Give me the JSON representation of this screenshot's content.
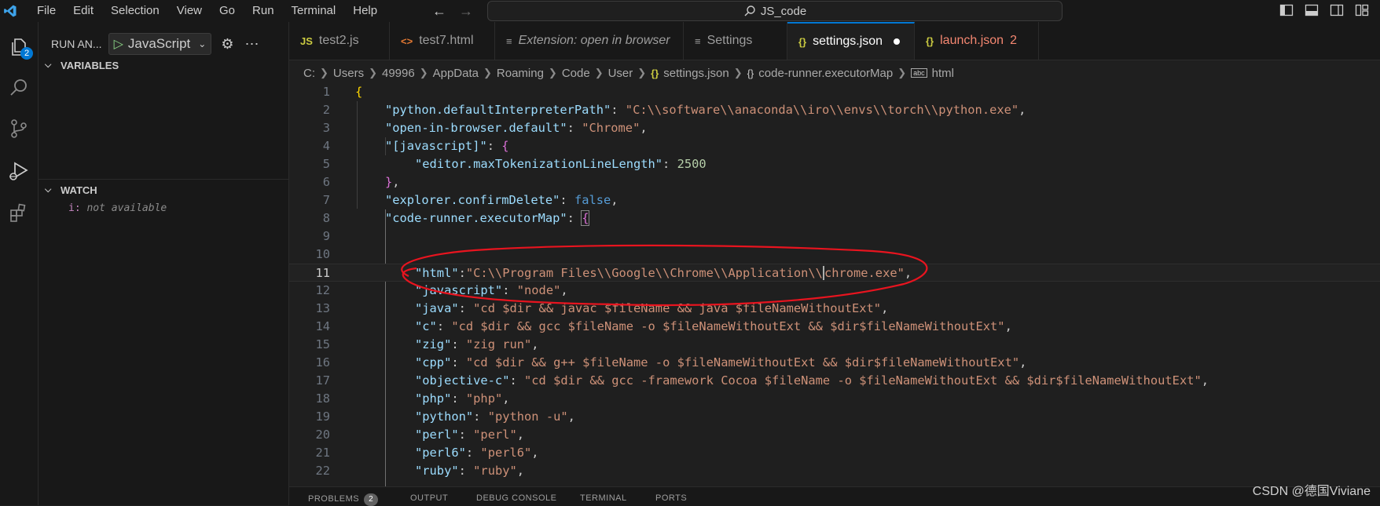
{
  "titlebar": {
    "menu": [
      "File",
      "Edit",
      "Selection",
      "View",
      "Go",
      "Run",
      "Terminal",
      "Help"
    ],
    "search_text": "JS_code"
  },
  "activitybar": {
    "explorer_badge": "2"
  },
  "sidebar": {
    "run_title": "RUN AN...",
    "launch_config": "JavaScript",
    "variables_header": "VARIABLES",
    "watch_header": "WATCH",
    "watch_item_name": "i:",
    "watch_item_value": "not available"
  },
  "tabs": [
    {
      "icon": "JS",
      "label": "test2.js"
    },
    {
      "icon": "<>",
      "label": "test7.html"
    },
    {
      "icon": "≡",
      "label": "Extension: open in browser"
    },
    {
      "icon": "≡",
      "label": "Settings"
    },
    {
      "icon": "{}",
      "label": "settings.json"
    },
    {
      "icon": "{}",
      "label": "launch.json",
      "count": "2"
    }
  ],
  "breadcrumb": [
    "C:",
    "Users",
    "49996",
    "AppData",
    "Roaming",
    "Code",
    "User",
    "settings.json",
    "code-runner.executorMap",
    "html"
  ],
  "editor": {
    "active_line": 11,
    "lines": [
      {
        "n": "1"
      },
      {
        "n": "2"
      },
      {
        "n": "3"
      },
      {
        "n": "4"
      },
      {
        "n": "5"
      },
      {
        "n": "6"
      },
      {
        "n": "7"
      },
      {
        "n": "8"
      },
      {
        "n": "9"
      },
      {
        "n": "10"
      },
      {
        "n": "11"
      },
      {
        "n": "12"
      },
      {
        "n": "13"
      },
      {
        "n": "14"
      },
      {
        "n": "15"
      },
      {
        "n": "16"
      },
      {
        "n": "17"
      },
      {
        "n": "18"
      },
      {
        "n": "19"
      },
      {
        "n": "20"
      },
      {
        "n": "21"
      },
      {
        "n": "22"
      }
    ],
    "tokens": {
      "l2k": "\"python.defaultInterpreterPath\"",
      "l2v": "\"C:\\\\software\\\\anaconda\\\\iro\\\\envs\\\\torch\\\\python.exe\"",
      "l3k": "\"open-in-browser.default\"",
      "l3v": "\"Chrome\"",
      "l4k": "\"[javascript]\"",
      "l5k": "\"editor.maxTokenizationLineLength\"",
      "l5v": "2500",
      "l7k": "\"explorer.confirmDelete\"",
      "l7v": "false",
      "l8k": "\"code-runner.executorMap\"",
      "l11k": "\"html\"",
      "l11v1": "\"C:\\\\Program Files\\\\Google\\\\Chrome\\\\Application\\\\",
      "l11v2": "chrome.exe\"",
      "l12k": "\"javascript\"",
      "l12v": "\"node\"",
      "l13k": "\"java\"",
      "l13v": "\"cd $dir && javac $fileName && java $fileNameWithoutExt\"",
      "l14k": "\"c\"",
      "l14v": "\"cd $dir && gcc $fileName -o $fileNameWithoutExt && $dir$fileNameWithoutExt\"",
      "l15k": "\"zig\"",
      "l15v": "\"zig run\"",
      "l16k": "\"cpp\"",
      "l16v": "\"cd $dir && g++ $fileName -o $fileNameWithoutExt && $dir$fileNameWithoutExt\"",
      "l17k": "\"objective-c\"",
      "l17v": "\"cd $dir && gcc -framework Cocoa $fileName -o $fileNameWithoutExt && $dir$fileNameWithoutExt\"",
      "l18k": "\"php\"",
      "l18v": "\"php\"",
      "l19k": "\"python\"",
      "l19v": "\"python -u\"",
      "l20k": "\"perl\"",
      "l20v": "\"perl\"",
      "l21k": "\"perl6\"",
      "l21v": "\"perl6\"",
      "l22k": "\"ruby\"",
      "l22v": "\"ruby\""
    }
  },
  "panel": {
    "tabs": [
      "PROBLEMS",
      "OUTPUT",
      "DEBUG CONSOLE",
      "TERMINAL",
      "PORTS"
    ],
    "problems_count": "2"
  },
  "watermark": "CSDN @德国Viviane",
  "colors": {
    "accent": "#0078d4",
    "annotation": "#e8141f"
  }
}
